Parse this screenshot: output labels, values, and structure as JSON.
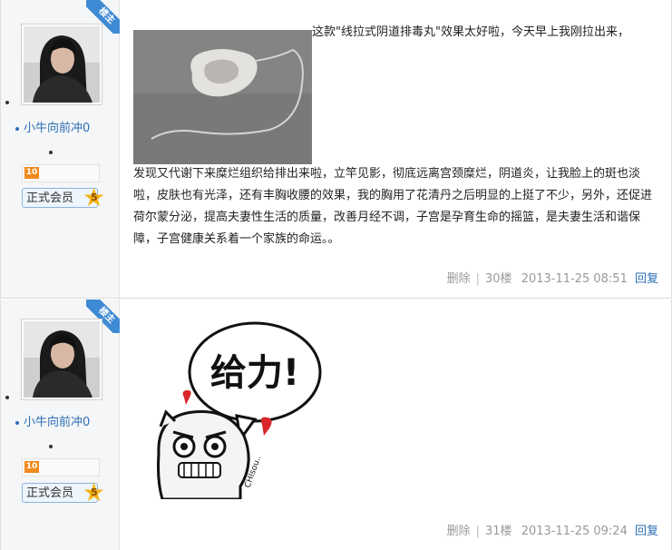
{
  "posts": [
    {
      "badge": "楼主",
      "username": "小牛向前冲0",
      "level": "10",
      "member_label": "正式会员",
      "member_star": "5",
      "text_first_line": "这款\"线拉式阴道排毒丸\"效果太好啦，今天早上我刚拉出来，",
      "text_rest": "发现又代谢下来糜烂组织给排出来啦，立竿见影，彻底远离宫颈糜烂，阴道炎，让我脸上的斑也淡啦，皮肤也有光泽，还有丰胸收腰的效果，我的胸用了花清丹之后明显的上挺了不少，另外，还促进荷尔蒙分泌，提高夫妻性生活的质量，改善月经不调，子宫是孕育生命的摇篮，是夫妻生活和谐保障，子宫健康关系着一个家族的命运。。",
      "delete_label": "删除",
      "floor": "30楼",
      "timestamp": "2013-11-25 08:51",
      "reply_label": "回复"
    },
    {
      "badge": "楼主",
      "username": "小牛向前冲0",
      "level": "10",
      "member_label": "正式会员",
      "member_star": "5",
      "bubble_text": "给力!",
      "sticker_tag": "CHIsou..",
      "delete_label": "删除",
      "floor": "31楼",
      "timestamp": "2013-11-25 09:24",
      "reply_label": "回复"
    }
  ]
}
